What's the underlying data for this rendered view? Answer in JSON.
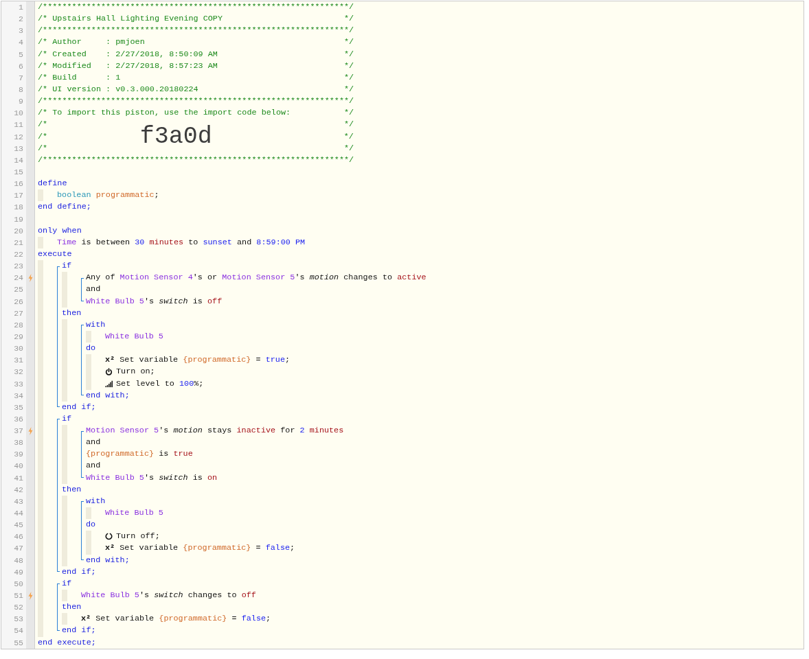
{
  "editor": {
    "lines": [
      {
        "n": "1",
        "trigger": false,
        "tokens": [
          {
            "kind": "comment",
            "text": "/***************************************************************/"
          }
        ]
      },
      {
        "n": "2",
        "trigger": false,
        "tokens": [
          {
            "kind": "frame",
            "text": "/* Upstairs Hall Lighting Evening COPY"
          },
          {
            "kind": "comment",
            "text": "*/"
          }
        ]
      },
      {
        "n": "3",
        "trigger": false,
        "tokens": [
          {
            "kind": "comment",
            "text": "/***************************************************************/"
          }
        ]
      },
      {
        "n": "4",
        "trigger": false,
        "tokens": [
          {
            "kind": "frame",
            "text": "/* Author     : pmjoen"
          },
          {
            "kind": "comment",
            "text": "*/"
          }
        ]
      },
      {
        "n": "5",
        "trigger": false,
        "tokens": [
          {
            "kind": "frame",
            "text": "/* Created    : 2/27/2018, 8:50:09 AM"
          },
          {
            "kind": "comment",
            "text": "*/"
          }
        ]
      },
      {
        "n": "6",
        "trigger": false,
        "tokens": [
          {
            "kind": "frame",
            "text": "/* Modified   : 2/27/2018, 8:57:23 AM"
          },
          {
            "kind": "comment",
            "text": "*/"
          }
        ]
      },
      {
        "n": "7",
        "trigger": false,
        "tokens": [
          {
            "kind": "frame",
            "text": "/* Build      : 1"
          },
          {
            "kind": "comment",
            "text": "*/"
          }
        ]
      },
      {
        "n": "8",
        "trigger": false,
        "tokens": [
          {
            "kind": "frame",
            "text": "/* UI version : v0.3.000.20180224"
          },
          {
            "kind": "comment",
            "text": "*/"
          }
        ]
      },
      {
        "n": "9",
        "trigger": false,
        "tokens": [
          {
            "kind": "comment",
            "text": "/***************************************************************/"
          }
        ]
      },
      {
        "n": "10",
        "trigger": false,
        "tokens": [
          {
            "kind": "frame",
            "text": "/* To import this piston, use the import code below:"
          },
          {
            "kind": "comment",
            "text": "*/"
          }
        ]
      },
      {
        "n": "11",
        "trigger": false,
        "tokens": [
          {
            "kind": "frame",
            "text": "/*"
          },
          {
            "kind": "comment",
            "text": "*/"
          }
        ]
      },
      {
        "n": "12",
        "trigger": false,
        "tokens": [
          {
            "kind": "lead",
            "text": "/*"
          },
          {
            "kind": "bigcode",
            "text": "f3a0d"
          },
          {
            "kind": "comment",
            "text": "*/"
          }
        ]
      },
      {
        "n": "13",
        "trigger": false,
        "tokens": [
          {
            "kind": "frame",
            "text": "/*"
          },
          {
            "kind": "comment",
            "text": "*/"
          }
        ]
      },
      {
        "n": "14",
        "trigger": false,
        "tokens": [
          {
            "kind": "comment",
            "text": "/***************************************************************/"
          }
        ]
      },
      {
        "n": "15",
        "trigger": false
      },
      {
        "n": "16",
        "trigger": false,
        "tokens": [
          {
            "kind": "kw",
            "text": "define"
          }
        ],
        "children": [
          {
            "n": "17",
            "trigger": false,
            "tokens": [
              {
                "kind": "type",
                "text": "boolean "
              },
              {
                "kind": "var",
                "text": "programmatic"
              },
              {
                "kind": "txt",
                "text": ";"
              }
            ]
          }
        ]
      },
      {
        "n": "18",
        "trigger": false,
        "tokens": [
          {
            "kind": "kw",
            "text": "end define;"
          }
        ]
      },
      {
        "n": "19",
        "trigger": false
      },
      {
        "n": "20",
        "trigger": false,
        "tokens": [
          {
            "kind": "kw",
            "text": "only when"
          }
        ],
        "children": [
          {
            "n": "21",
            "trigger": false,
            "tokens": [
              {
                "kind": "dev",
                "text": "Time"
              },
              {
                "kind": "txt",
                "text": " is between "
              },
              {
                "kind": "num",
                "text": "30"
              },
              {
                "kind": "val",
                "text": " minutes"
              },
              {
                "kind": "txt",
                "text": " to "
              },
              {
                "kind": "num",
                "text": "sunset"
              },
              {
                "kind": "txt",
                "text": " and "
              },
              {
                "kind": "num",
                "text": "8:59:00 PM"
              }
            ]
          }
        ]
      },
      {
        "n": "22",
        "trigger": false,
        "tokens": [
          {
            "kind": "kw",
            "text": "execute"
          }
        ],
        "children": [
          {
            "block": [
              {
                "n": "23",
                "trigger": false,
                "tokens": [
                  {
                    "kind": "kw",
                    "text": "if"
                  }
                ],
                "children": [
                  {
                    "block": [
                      {
                        "n": "24",
                        "trigger": true,
                        "tokens": [
                          {
                            "kind": "txt",
                            "text": "Any of "
                          },
                          {
                            "kind": "dev",
                            "text": "Motion Sensor 4"
                          },
                          {
                            "kind": "txt",
                            "text": "'s or "
                          },
                          {
                            "kind": "dev",
                            "text": "Motion Sensor 5"
                          },
                          {
                            "kind": "txt",
                            "text": "'s "
                          },
                          {
                            "kind": "attr",
                            "text": "motion"
                          },
                          {
                            "kind": "txt",
                            "text": " changes to "
                          },
                          {
                            "kind": "val",
                            "text": "active"
                          }
                        ]
                      },
                      {
                        "n": "25",
                        "trigger": false,
                        "tokens": [
                          {
                            "kind": "txt",
                            "text": "and"
                          }
                        ]
                      },
                      {
                        "n": "26",
                        "trigger": false,
                        "tokens": [
                          {
                            "kind": "dev",
                            "text": "White Bulb 5"
                          },
                          {
                            "kind": "txt",
                            "text": "'s "
                          },
                          {
                            "kind": "attr",
                            "text": "switch"
                          },
                          {
                            "kind": "txt",
                            "text": " is "
                          },
                          {
                            "kind": "val",
                            "text": "off"
                          }
                        ]
                      }
                    ]
                  }
                ]
              },
              {
                "n": "27",
                "trigger": false,
                "tokens": [
                  {
                    "kind": "kw",
                    "text": "then"
                  }
                ],
                "children": [
                  {
                    "block": [
                      {
                        "n": "28",
                        "trigger": false,
                        "tokens": [
                          {
                            "kind": "kw",
                            "text": "with"
                          }
                        ],
                        "children": [
                          {
                            "n": "29",
                            "trigger": false,
                            "tokens": [
                              {
                                "kind": "dev",
                                "text": "White Bulb 5"
                              }
                            ]
                          }
                        ]
                      },
                      {
                        "n": "30",
                        "trigger": false,
                        "tokens": [
                          {
                            "kind": "kw",
                            "text": "do"
                          }
                        ],
                        "children": [
                          {
                            "n": "31",
                            "trigger": false,
                            "tokens": [
                              {
                                "kind": "glyph",
                                "text": "x²"
                              },
                              {
                                "kind": "txt",
                                "text": " Set variable "
                              },
                              {
                                "kind": "var",
                                "text": "{programmatic}"
                              },
                              {
                                "kind": "txt",
                                "text": " = "
                              },
                              {
                                "kind": "num",
                                "text": "true"
                              },
                              {
                                "kind": "txt",
                                "text": ";"
                              }
                            ]
                          },
                          {
                            "n": "32",
                            "trigger": false,
                            "tokens": [
                              {
                                "kind": "power-icon"
                              },
                              {
                                "kind": "txt",
                                "text": "Turn on;"
                              }
                            ]
                          },
                          {
                            "n": "33",
                            "trigger": false,
                            "tokens": [
                              {
                                "kind": "signal-icon"
                              },
                              {
                                "kind": "txt",
                                "text": "Set level to "
                              },
                              {
                                "kind": "num",
                                "text": "100"
                              },
                              {
                                "kind": "txt",
                                "text": "%;"
                              }
                            ]
                          }
                        ]
                      },
                      {
                        "n": "34",
                        "trigger": false,
                        "tokens": [
                          {
                            "kind": "kw",
                            "text": "end with;"
                          }
                        ]
                      }
                    ]
                  }
                ]
              },
              {
                "n": "35",
                "trigger": false,
                "tokens": [
                  {
                    "kind": "kw",
                    "text": "end if;"
                  }
                ]
              }
            ]
          },
          {
            "block": [
              {
                "n": "36",
                "trigger": false,
                "tokens": [
                  {
                    "kind": "kw",
                    "text": "if"
                  }
                ],
                "children": [
                  {
                    "block": [
                      {
                        "n": "37",
                        "trigger": true,
                        "tokens": [
                          {
                            "kind": "dev",
                            "text": "Motion Sensor 5"
                          },
                          {
                            "kind": "txt",
                            "text": "'s "
                          },
                          {
                            "kind": "attr",
                            "text": "motion"
                          },
                          {
                            "kind": "txt",
                            "text": " stays "
                          },
                          {
                            "kind": "val",
                            "text": "inactive"
                          },
                          {
                            "kind": "txt",
                            "text": " for "
                          },
                          {
                            "kind": "num",
                            "text": "2"
                          },
                          {
                            "kind": "val",
                            "text": " minutes"
                          }
                        ]
                      },
                      {
                        "n": "38",
                        "trigger": false,
                        "tokens": [
                          {
                            "kind": "txt",
                            "text": "and"
                          }
                        ]
                      },
                      {
                        "n": "39",
                        "trigger": false,
                        "tokens": [
                          {
                            "kind": "var",
                            "text": "{programmatic}"
                          },
                          {
                            "kind": "txt",
                            "text": " is "
                          },
                          {
                            "kind": "val",
                            "text": "true"
                          }
                        ]
                      },
                      {
                        "n": "40",
                        "trigger": false,
                        "tokens": [
                          {
                            "kind": "txt",
                            "text": "and"
                          }
                        ]
                      },
                      {
                        "n": "41",
                        "trigger": false,
                        "tokens": [
                          {
                            "kind": "dev",
                            "text": "White Bulb 5"
                          },
                          {
                            "kind": "txt",
                            "text": "'s "
                          },
                          {
                            "kind": "attr",
                            "text": "switch"
                          },
                          {
                            "kind": "txt",
                            "text": " is "
                          },
                          {
                            "kind": "val",
                            "text": "on"
                          }
                        ]
                      }
                    ]
                  }
                ]
              },
              {
                "n": "42",
                "trigger": false,
                "tokens": [
                  {
                    "kind": "kw",
                    "text": "then"
                  }
                ],
                "children": [
                  {
                    "block": [
                      {
                        "n": "43",
                        "trigger": false,
                        "tokens": [
                          {
                            "kind": "kw",
                            "text": "with"
                          }
                        ],
                        "children": [
                          {
                            "n": "44",
                            "trigger": false,
                            "tokens": [
                              {
                                "kind": "dev",
                                "text": "White Bulb 5"
                              }
                            ]
                          }
                        ]
                      },
                      {
                        "n": "45",
                        "trigger": false,
                        "tokens": [
                          {
                            "kind": "kw",
                            "text": "do"
                          }
                        ],
                        "children": [
                          {
                            "n": "46",
                            "trigger": false,
                            "tokens": [
                              {
                                "kind": "ring-icon"
                              },
                              {
                                "kind": "txt",
                                "text": "Turn off;"
                              }
                            ]
                          },
                          {
                            "n": "47",
                            "trigger": false,
                            "tokens": [
                              {
                                "kind": "glyph",
                                "text": "x²"
                              },
                              {
                                "kind": "txt",
                                "text": " Set variable "
                              },
                              {
                                "kind": "var",
                                "text": "{programmatic}"
                              },
                              {
                                "kind": "txt",
                                "text": " = "
                              },
                              {
                                "kind": "num",
                                "text": "false"
                              },
                              {
                                "kind": "txt",
                                "text": ";"
                              }
                            ]
                          }
                        ]
                      },
                      {
                        "n": "48",
                        "trigger": false,
                        "tokens": [
                          {
                            "kind": "kw",
                            "text": "end with;"
                          }
                        ]
                      }
                    ]
                  }
                ]
              },
              {
                "n": "49",
                "trigger": false,
                "tokens": [
                  {
                    "kind": "kw",
                    "text": "end if;"
                  }
                ]
              }
            ]
          },
          {
            "block": [
              {
                "n": "50",
                "trigger": false,
                "tokens": [
                  {
                    "kind": "kw",
                    "text": "if"
                  }
                ],
                "children": [
                  {
                    "n": "51",
                    "trigger": true,
                    "tokens": [
                      {
                        "kind": "dev",
                        "text": "White Bulb 5"
                      },
                      {
                        "kind": "txt",
                        "text": "'s "
                      },
                      {
                        "kind": "attr",
                        "text": "switch"
                      },
                      {
                        "kind": "txt",
                        "text": " changes to "
                      },
                      {
                        "kind": "val",
                        "text": "off"
                      }
                    ]
                  }
                ]
              },
              {
                "n": "52",
                "trigger": false,
                "tokens": [
                  {
                    "kind": "kw",
                    "text": "then"
                  }
                ],
                "children": [
                  {
                    "n": "53",
                    "trigger": false,
                    "tokens": [
                      {
                        "kind": "glyph",
                        "text": "x²"
                      },
                      {
                        "kind": "txt",
                        "text": " Set variable "
                      },
                      {
                        "kind": "var",
                        "text": "{programmatic}"
                      },
                      {
                        "kind": "txt",
                        "text": " = "
                      },
                      {
                        "kind": "num",
                        "text": "false"
                      },
                      {
                        "kind": "txt",
                        "text": ";"
                      }
                    ]
                  }
                ]
              },
              {
                "n": "54",
                "trigger": false,
                "tokens": [
                  {
                    "kind": "kw",
                    "text": "end if;"
                  }
                ]
              }
            ]
          }
        ]
      },
      {
        "n": "55",
        "trigger": false,
        "tokens": [
          {
            "kind": "kw",
            "text": "end execute;"
          }
        ]
      }
    ]
  }
}
